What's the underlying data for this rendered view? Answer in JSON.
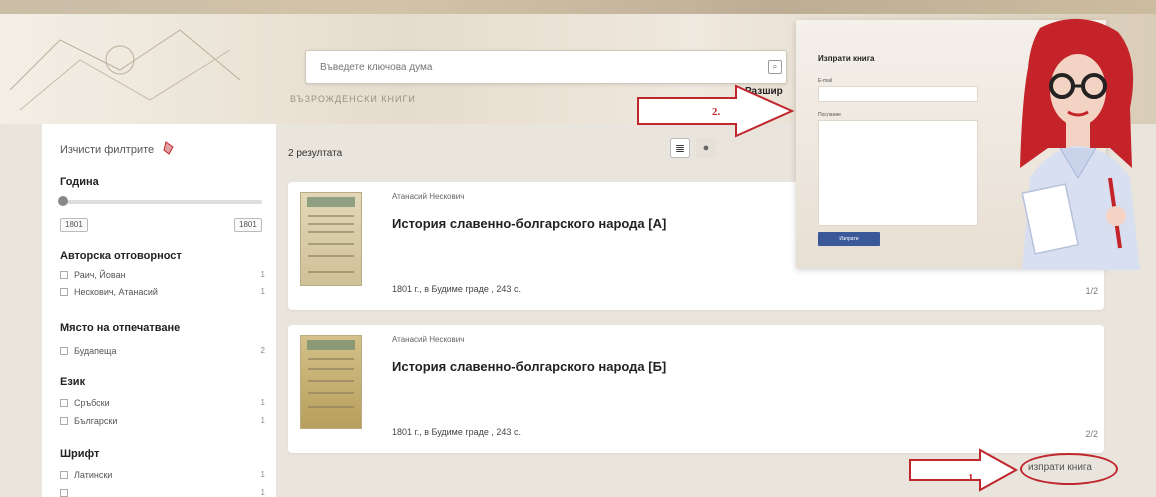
{
  "search": {
    "placeholder": "Въведете ключова дума"
  },
  "header": {
    "faint_text": "ВЪЗРОЖДЕНСКИ КНИГИ",
    "advanced_link": "Разшир"
  },
  "sidebar": {
    "clear_filters": "Изчисти филтрите",
    "year": {
      "heading": "Година",
      "from": "1801",
      "to": "1801"
    },
    "authorship": {
      "heading": "Авторска отговорност",
      "items": [
        {
          "label": "Раич, Йован",
          "count": "1"
        },
        {
          "label": "Нескович, Атанасий",
          "count": "1"
        }
      ]
    },
    "place": {
      "heading": "Място на отпечатване",
      "items": [
        {
          "label": "Будапеща",
          "count": "2"
        }
      ]
    },
    "language": {
      "heading": "Език",
      "items": [
        {
          "label": "Сръбски",
          "count": "1"
        },
        {
          "label": "Български",
          "count": "1"
        }
      ]
    },
    "font": {
      "heading": "Шрифт",
      "items": [
        {
          "label": "Латински",
          "count": "1"
        },
        {
          "label": "",
          "count": "1"
        }
      ]
    }
  },
  "results": {
    "count_label": "2 резултата",
    "items": [
      {
        "author": "Атанасий Нескович",
        "title": "История славенно-болгарского народа [А]",
        "meta": "1801 г., в Будиме граде , 243 с.",
        "pager": "1/2"
      },
      {
        "author": "Атанасий Нескович",
        "title": "История славенно-болгарского народа [Б]",
        "meta": "1801 г., в Будиме граде , 243 с.",
        "pager": "2/2"
      }
    ],
    "send_book_link": "изпрати книга"
  },
  "popup": {
    "title": "Изпрати книга",
    "email_label": "E-mail",
    "message_label": "Послание",
    "send_button": "Изпрати"
  },
  "annotations": {
    "step1": "1.",
    "step2": "2."
  },
  "colors": {
    "accent_red": "#c0272d",
    "button_blue": "#3b5898"
  },
  "icons": [
    "search-icon",
    "eraser-icon",
    "list-view-icon",
    "map-pin-icon",
    "close-icon"
  ]
}
